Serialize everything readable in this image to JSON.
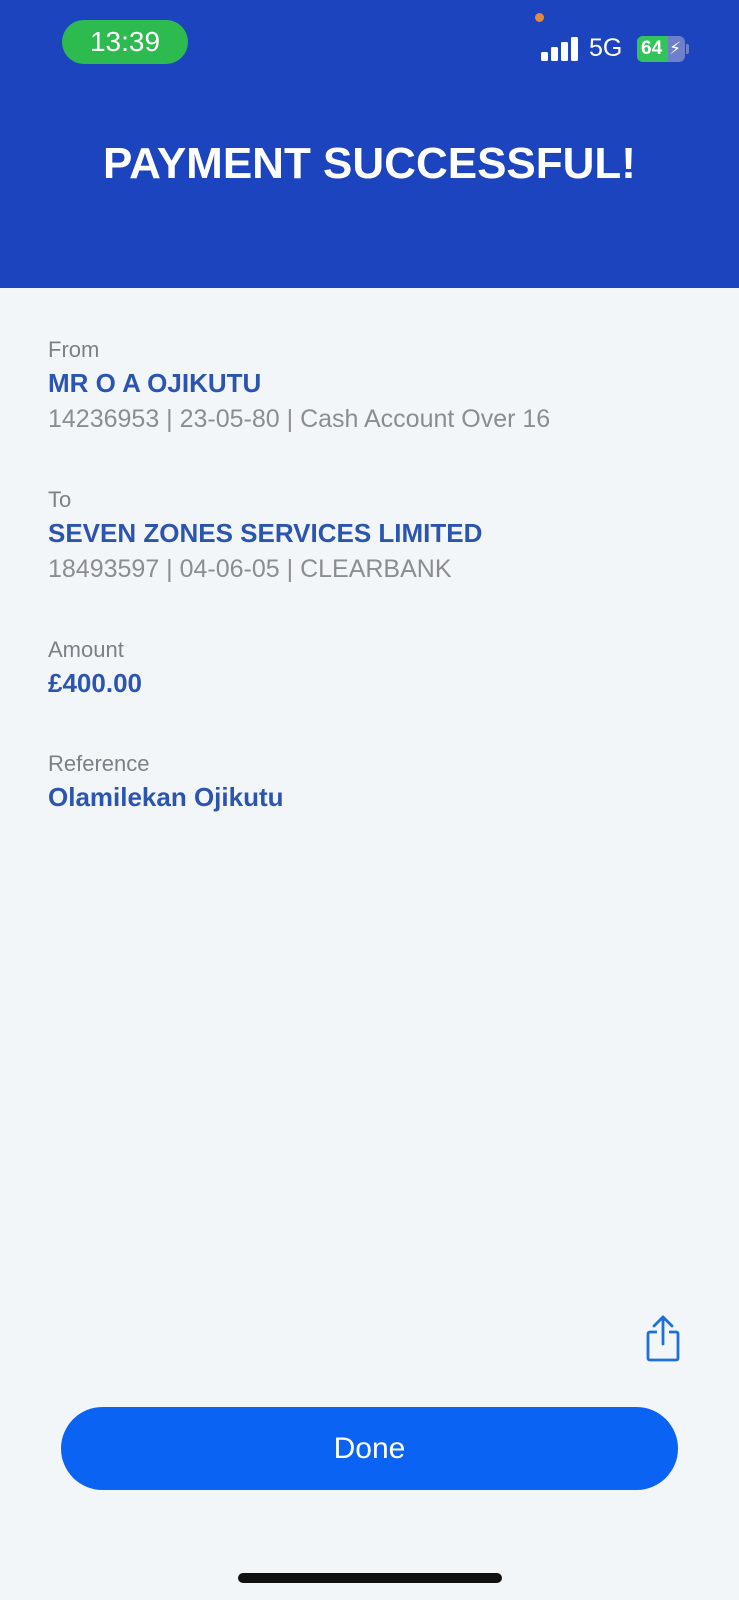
{
  "status_bar": {
    "time": "13:39",
    "network": "5G",
    "battery_percent": "64",
    "battery_level": 0.64,
    "signal_bars": 4
  },
  "header": {
    "title": "PAYMENT SUCCESSFUL!"
  },
  "payment": {
    "from": {
      "label": "From",
      "name": "MR O A OJIKUTU",
      "details": "14236953 | 23-05-80 | Cash Account Over 16"
    },
    "to": {
      "label": "To",
      "name": "SEVEN ZONES SERVICES LIMITED",
      "details": "18493597 | 04-06-05 | CLEARBANK"
    },
    "amount": {
      "label": "Amount",
      "value": "£400.00"
    },
    "reference": {
      "label": "Reference",
      "value": "Olamilekan Ojikutu"
    }
  },
  "actions": {
    "share_icon": "share-icon",
    "done_label": "Done"
  },
  "colors": {
    "header_bg": "#1b44be",
    "accent_text": "#2c55b0",
    "primary_button": "#0b63f3",
    "page_bg": "#f3f6f9"
  }
}
